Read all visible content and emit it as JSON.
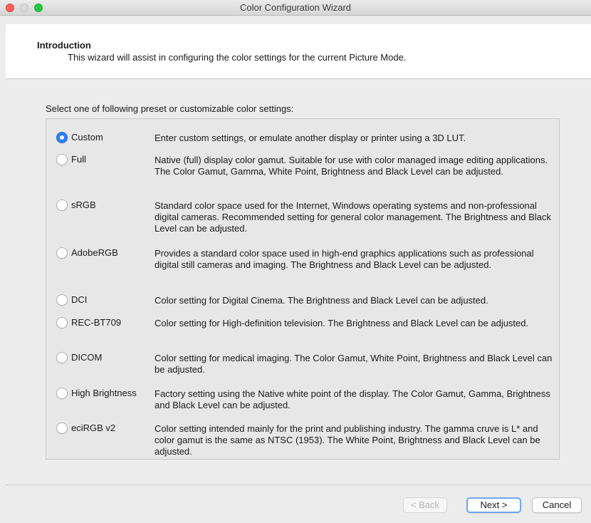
{
  "window": {
    "title": "Color Configuration Wizard"
  },
  "header": {
    "title": "Introduction",
    "description": "This wizard will assist in configuring the color settings for the current Picture Mode."
  },
  "prompt": "Select one of following preset or customizable color settings:",
  "options": [
    {
      "label": "Custom",
      "selected": true,
      "description": "Enter custom settings, or emulate another display or printer using a 3D LUT."
    },
    {
      "label": "Full",
      "selected": false,
      "description": "Native (full) display color gamut. Suitable for use with color managed image editing applications. The Color Gamut, Gamma, White Point, Brightness and Black Level can be adjusted."
    },
    {
      "label": "sRGB",
      "selected": false,
      "description": "Standard color space used for the Internet, Windows operating systems and non-professional digital cameras. Recommended setting for general color management. The Brightness and Black Level can be adjusted."
    },
    {
      "label": "AdobeRGB",
      "selected": false,
      "description": "Provides a standard color space used in high-end graphics applications such as professional digital still cameras and imaging. The Brightness and Black Level can be adjusted."
    },
    {
      "label": "DCI",
      "selected": false,
      "description": "Color setting for Digital Cinema. The Brightness and Black Level can be adjusted."
    },
    {
      "label": "REC-BT709",
      "selected": false,
      "description": "Color setting for High-definition television. The Brightness and Black Level can be adjusted."
    },
    {
      "label": "DICOM",
      "selected": false,
      "description": "Color setting for medical imaging. The Color Gamut, White Point, Brightness and Black Level can be adjusted."
    },
    {
      "label": "High Brightness",
      "selected": false,
      "description": "Factory setting using the Native white point of the display. The Color Gamut, Gamma, Brightness and Black Level can be adjusted."
    },
    {
      "label": "eciRGB v2",
      "selected": false,
      "description": "Color setting intended mainly for the print and publishing industry. The gamma cruve is L* and color gamut is the same as NTSC (1953). The White Point, Brightness and Black Level can be adjusted."
    }
  ],
  "buttons": {
    "back": "< Back",
    "next": "Next >",
    "cancel": "Cancel"
  },
  "colors": {
    "accent": "#2f7cf6",
    "close": "#fe5f57",
    "maximize": "#28c840"
  }
}
